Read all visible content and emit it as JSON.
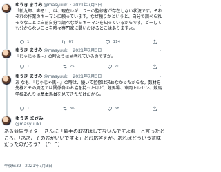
{
  "tweets": [
    {
      "name": "ゆうき まさみ",
      "handle": "@masyuuki",
      "sep": "·",
      "date": "2021年7月3日",
      "text": "「新九郎、奔る！」は、現在レギュラーの監修者が存在しない状況です。それぞれの作業のキーマンに頼っています。なぜ頼りかというと、自分で調べられそうなことは自前自分で調べながらキーマンを知っているからです。どーしても分からないことを時々専門家に聞いおけるとこはありますよ。",
      "replies": "1",
      "retweets": "67",
      "likes": "114"
    },
    {
      "name": "ゆうき まさみ",
      "handle": "@masyuuki",
      "sep": "·",
      "date": "2021年7月3日",
      "text": "『じゃじゃ馬~』の時ようは見者れているのですが。",
      "replies": "1",
      "retweets": "25",
      "likes": "70"
    },
    {
      "name": "ゆうき まさみ",
      "handle": "@masyuuki",
      "sep": "·",
      "date": "2021年7月3日",
      "text": "あ なも、『じゃじゃ馬~』の時は、優いて監修は求めなかったからな。数材を先様とその周辺では関係各のお協を持ったけど、競馬場、車両トレセン、競馬学校あたりは基本馬員を見てきただけだから。",
      "replies": "1",
      "retweets": "36",
      "likes": "68"
    }
  ],
  "main": {
    "name": "ゆうき まさみ",
    "handle": "@masyuuki",
    "text": "ある競馬ライター さんに「騎手の取材はしてないんですよね」と言ったところ、「ああ、その方がいいですよ」とお応答えが。あればどういう意味だったのだろう？（^_^）",
    "timestamp": "午後6:39 · 2021年7月3日"
  }
}
